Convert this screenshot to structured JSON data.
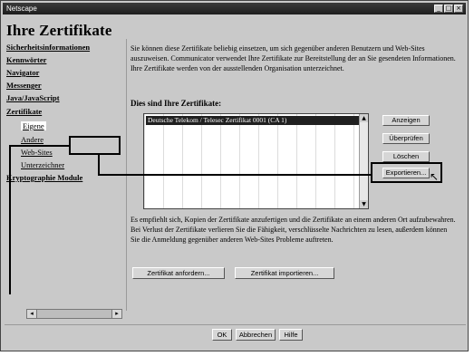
{
  "window": {
    "title": "Netscape",
    "controls": [
      "_",
      "□",
      "×"
    ]
  },
  "page": {
    "title": "Ihre Zertifikate"
  },
  "sidebar": {
    "items": [
      {
        "label": "Sicherheitsinformationen"
      },
      {
        "label": "Kennwörter"
      },
      {
        "label": "Navigator"
      },
      {
        "label": "Messenger"
      },
      {
        "label": "Java/JavaScript"
      },
      {
        "label": "Zertifikate"
      },
      {
        "label": "Eigene"
      },
      {
        "label": "Andere"
      },
      {
        "label": "Web-Sites"
      },
      {
        "label": "Unterzeichner"
      },
      {
        "label": "Kryptographie Module"
      }
    ],
    "scroll_left": "◂",
    "scroll_right": "▸"
  },
  "main": {
    "description": "Sie können diese Zertifikate beliebig einsetzen, um sich gegenüber anderen Benutzern und Web-Sites auszuweisen. Communicator verwendet Ihre Zertifikate zur Bereitstellung der an Sie gesendeten Informationen. Ihre Zertifikate werden von der ausstellenden Organisation unterzeichnet.",
    "cert_heading": "Dies sind Ihre Zertifikate:",
    "certificates": [
      {
        "name": "Deutsche Telekom / Telesec Zertifikat 0001 (CA 1)"
      }
    ],
    "list_up": "▲",
    "list_down": "▼",
    "buttons": {
      "view": "Anzeigen",
      "verify": "Überprüfen",
      "delete": "Löschen",
      "export": "Exportieren..."
    },
    "note": "Es empfiehlt sich, Kopien der Zertifikate anzufertigen und die Zertifikate an einem anderen Ort aufzubewahren. Bei Verlust der Zertifikate verlieren Sie die Fähigkeit, verschlüsselte Nachrichten zu lesen, außerdem können Sie die Anmeldung gegenüber anderen Web-Sites Probleme auftreten.",
    "bottom_buttons": {
      "obtain": "Zertifikat anfordern...",
      "import": "Zertifikat importieren..."
    }
  },
  "dialog": {
    "ok": "OK",
    "cancel": "Abbrechen",
    "help": "Hilfe"
  },
  "cursor_glyph": "↖"
}
